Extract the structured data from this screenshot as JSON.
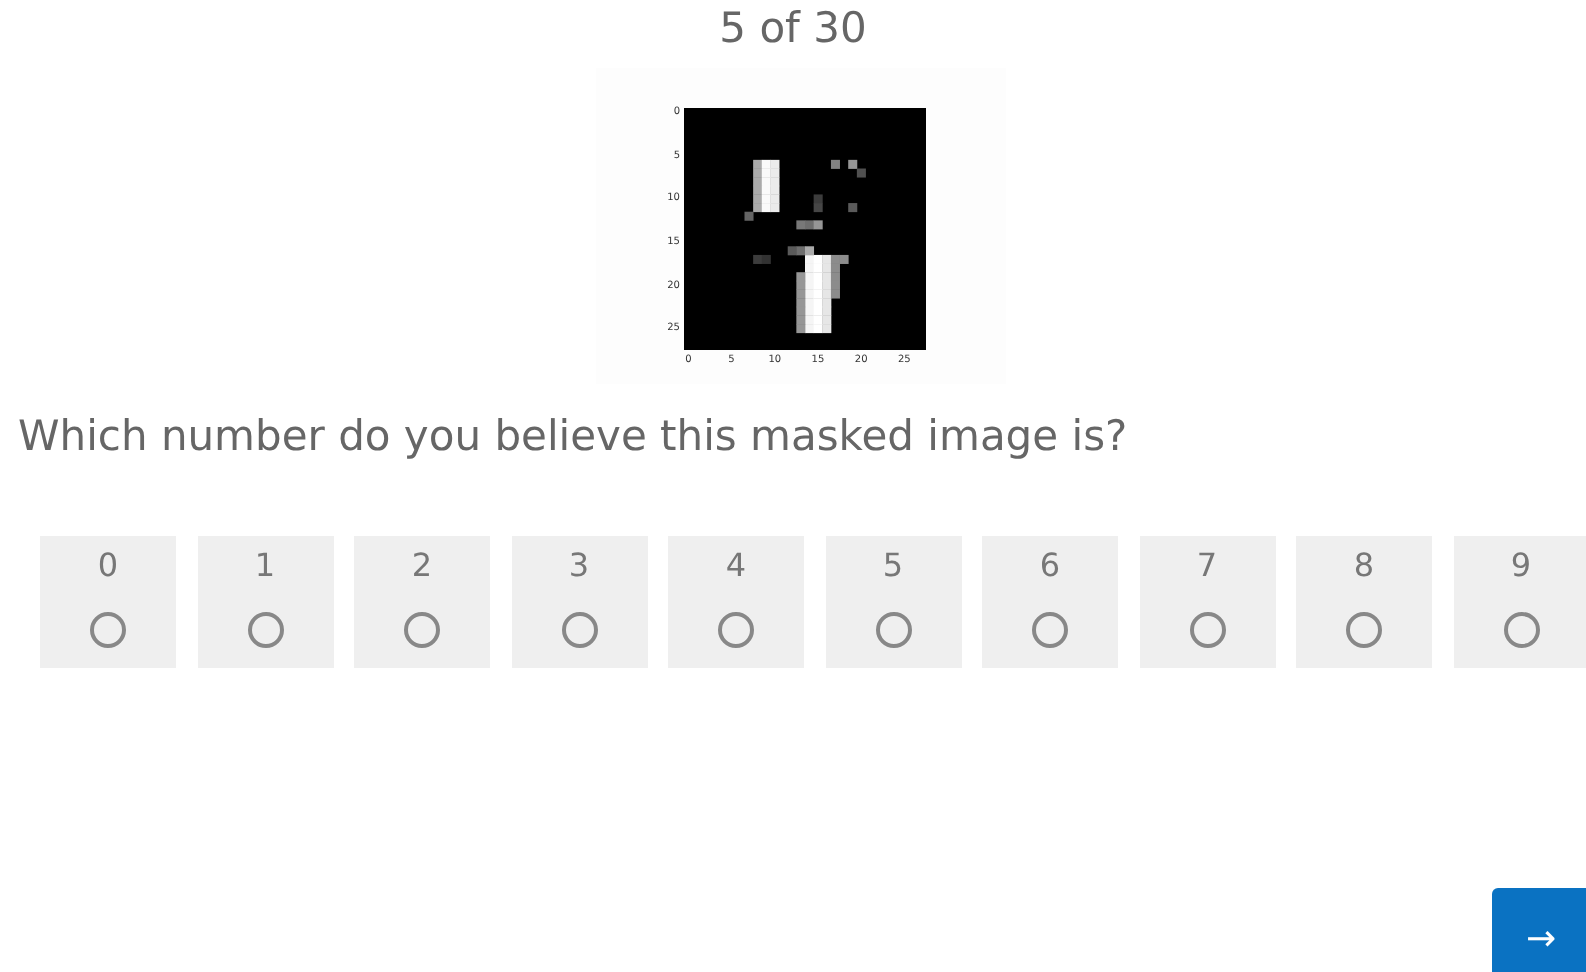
{
  "progress": "5 of 30",
  "plot": {
    "kind": "picture",
    "xticks": [
      "0",
      "5",
      "10",
      "15",
      "20",
      "25"
    ],
    "yticks": [
      "0",
      "5",
      "10",
      "15",
      "20",
      "25"
    ]
  },
  "question": "Which number do you believe this masked image is?",
  "options": [
    {
      "label": "0",
      "selected": false
    },
    {
      "label": "1",
      "selected": false
    },
    {
      "label": "2",
      "selected": false
    },
    {
      "label": "3",
      "selected": false
    },
    {
      "label": "4",
      "selected": false
    },
    {
      "label": "5",
      "selected": false
    },
    {
      "label": "6",
      "selected": false
    },
    {
      "label": "7",
      "selected": false
    },
    {
      "label": "8",
      "selected": false
    },
    {
      "label": "9",
      "selected": false
    }
  ],
  "next_button": "→"
}
